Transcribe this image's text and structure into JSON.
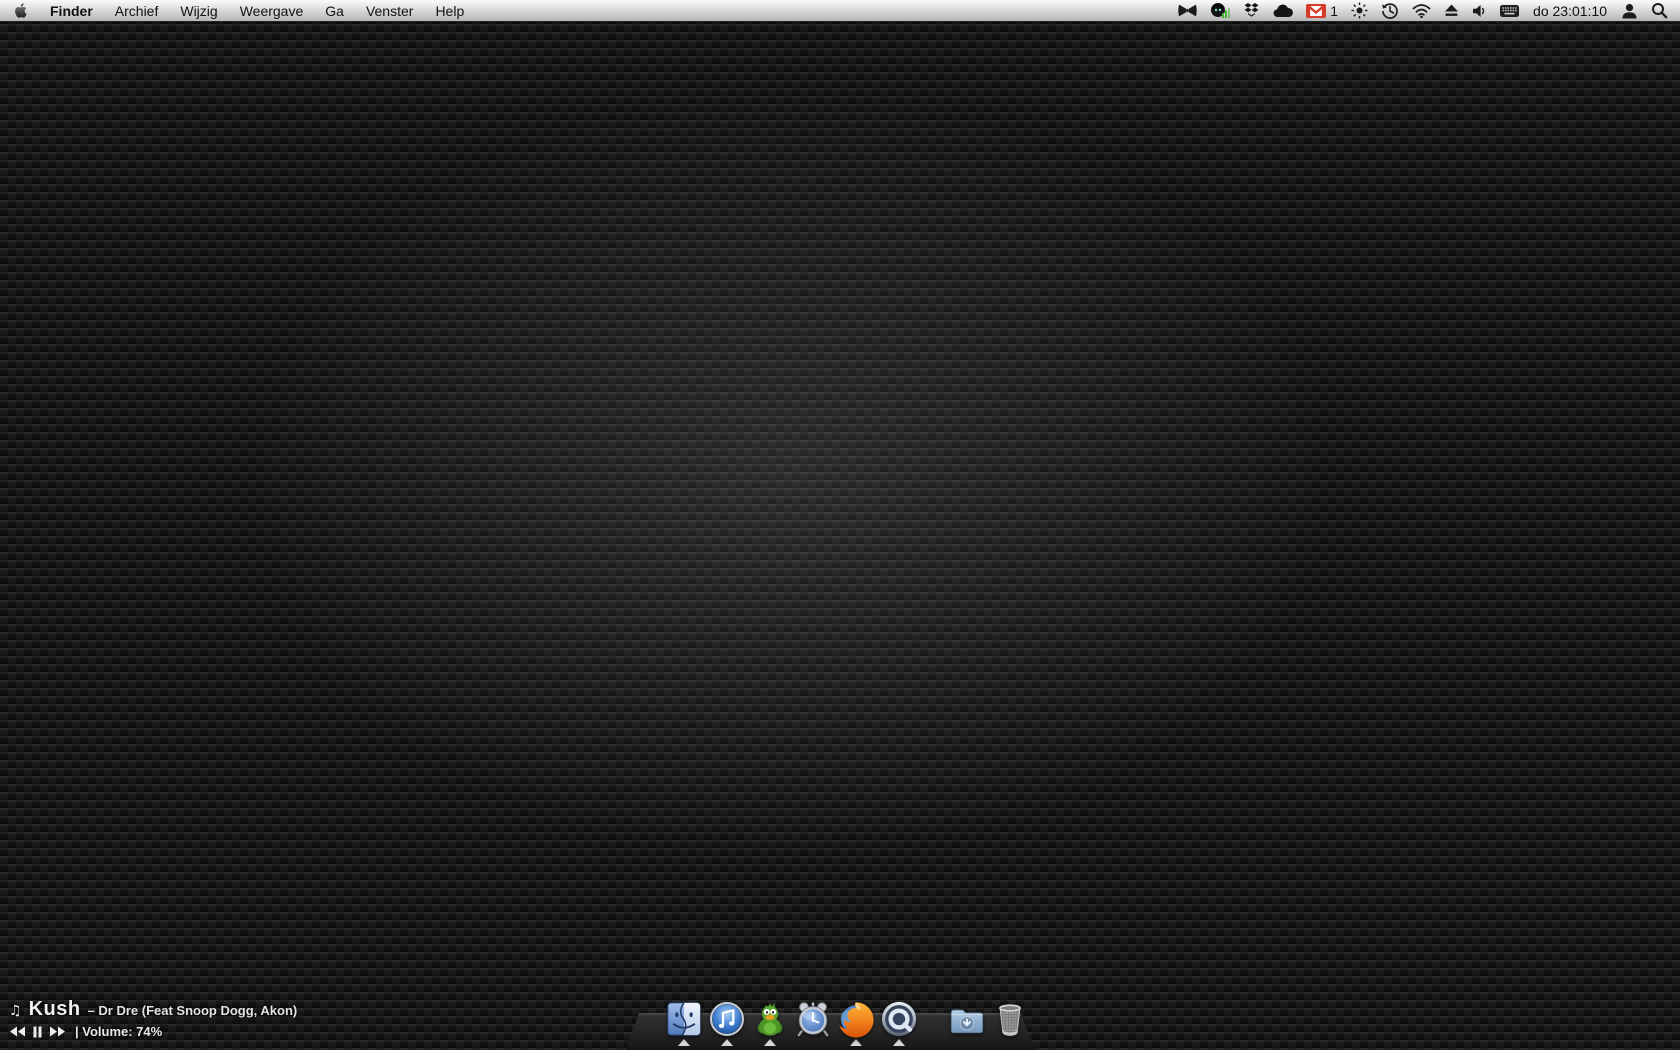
{
  "menu_bar": {
    "app_menu": "Finder",
    "menus": [
      "Archief",
      "Wijzig",
      "Weergave",
      "Ga",
      "Venster",
      "Help"
    ],
    "gmail_unread": "1",
    "clock": "do 23:01:10",
    "status_icons": [
      "bowtie-icon",
      "app-monitor-icon",
      "dropbox-icon",
      "cloud-icon",
      "gmail-icon",
      "brightness-icon",
      "time-machine-icon",
      "wifi-icon",
      "eject-icon",
      "volume-icon",
      "keyboard-icon",
      "user-icon",
      "spotlight-icon"
    ]
  },
  "now_playing": {
    "note_icon": "♫",
    "title": "Kush",
    "subtitle": "– Dr Dre (Feat Snoop Dogg, Akon)",
    "volume_text": "| Volume: 74%"
  },
  "dock": {
    "items": [
      {
        "name": "finder",
        "running": true
      },
      {
        "name": "itunes",
        "running": true
      },
      {
        "name": "adium",
        "running": true
      },
      {
        "name": "alarm-clock",
        "running": false
      },
      {
        "name": "firefox",
        "running": true
      },
      {
        "name": "quicktime",
        "running": true
      },
      {
        "name": "downloads-folder",
        "running": false
      },
      {
        "name": "trash",
        "running": false
      }
    ]
  },
  "colors": {
    "menubar_icon": "#1c1c1c",
    "gmail_red": "#d33d2a",
    "indicator": "#d6d6d6",
    "accent_blue": "#4f7ec9"
  }
}
